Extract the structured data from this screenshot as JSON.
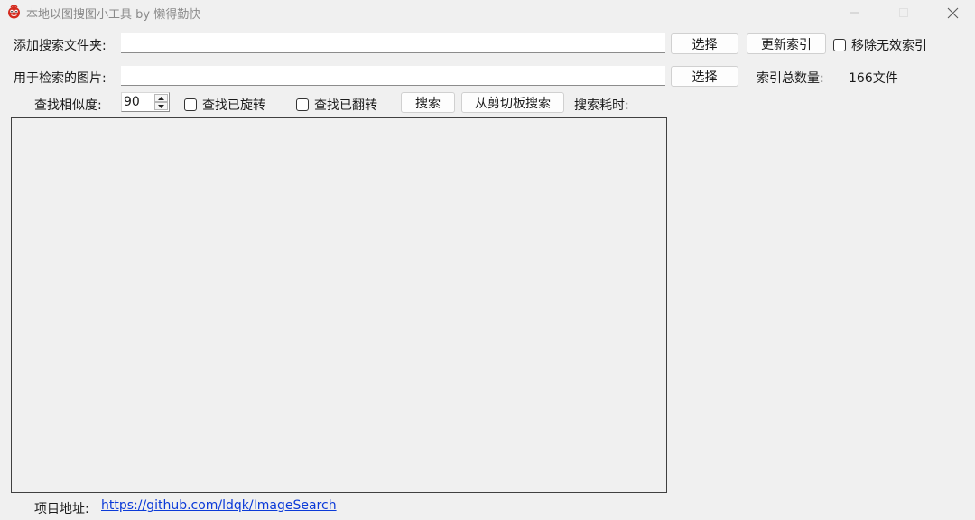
{
  "window": {
    "title": "本地以图搜图小工具 by 懒得勤快",
    "accent_color": "#0b3ad8",
    "icons": [
      "app-icon",
      "minimize-icon",
      "maximize-icon",
      "close-icon"
    ]
  },
  "folder_row": {
    "label": "添加搜索文件夹:",
    "value": "",
    "choose_label": "选择",
    "update_index_label": "更新索引",
    "remove_invalid_label": "移除无效索引",
    "remove_invalid_checked": false
  },
  "image_row": {
    "label": "用于检索的图片:",
    "value": "",
    "choose_label": "选择",
    "index_count_label": "索引总数量:",
    "index_count_value": "166文件"
  },
  "search_row": {
    "similarity_label": "查找相似度:",
    "similarity_value": "90",
    "find_rotated_label": "查找已旋转",
    "find_rotated_checked": false,
    "find_flipped_label": "查找已翻转",
    "find_flipped_checked": false,
    "search_label": "搜索",
    "clipboard_search_label": "从剪切板搜索",
    "elapsed_label": "搜索耗时:"
  },
  "footer": {
    "project_label": "项目地址:",
    "project_url": "https://github.com/ldqk/ImageSearch"
  }
}
